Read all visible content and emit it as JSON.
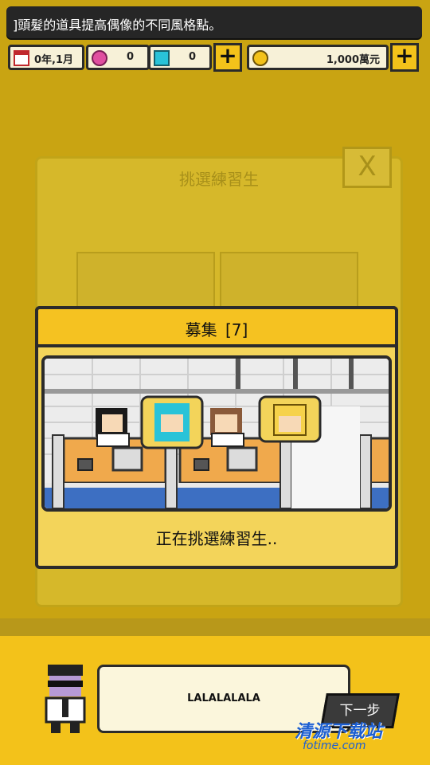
{
  "ticker": {
    "text": "]頭髮的道具提高偶像的不同風格點。"
  },
  "resources": {
    "date": "0年,1月",
    "pink_gems": "0",
    "blue_gems": "0",
    "money": "1,000萬元"
  },
  "background_panel": {
    "title": "挑選練習生",
    "close": "X"
  },
  "modal": {
    "title": "募集",
    "count": "[7]",
    "status": "正在挑選練習生.."
  },
  "dialog": {
    "text": "LALALALALA"
  },
  "next_button": {
    "label": "下一步"
  },
  "watermark": {
    "text": "清源下载站",
    "sub": "fotime.com"
  },
  "colors": {
    "accent": "#f3c21a",
    "dark": "#2b2b2b",
    "dim_bg": "#c9a412",
    "pink": "#e04fa0",
    "cyan": "#29c3d8"
  }
}
